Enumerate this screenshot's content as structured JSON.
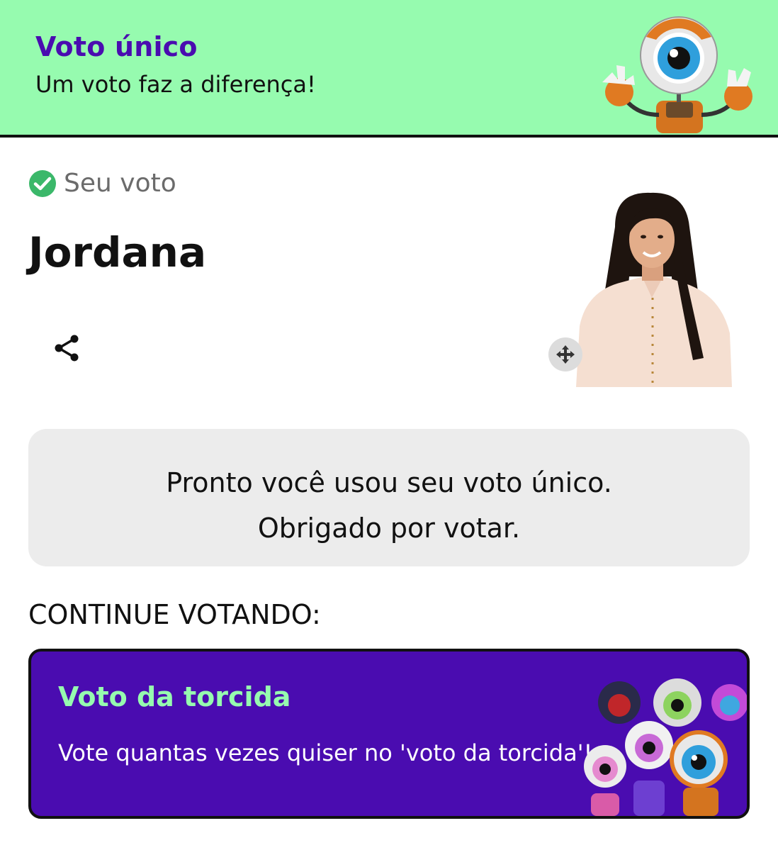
{
  "header": {
    "title": "Voto único",
    "subtitle": "Um voto faz a diferença!",
    "mascot_icon": "big-brother-eye-robot"
  },
  "vote": {
    "status_label": "Seu voto",
    "status_icon": "check-circle-icon",
    "candidate_name": "Jordana",
    "share_icon": "share-icon",
    "move_icon": "move-arrows-icon"
  },
  "notice": {
    "line1": "Pronto você usou seu voto único.",
    "line2": "Obrigado por votar."
  },
  "continue_label": "CONTINUE VOTANDO:",
  "fan_vote_card": {
    "title": "Voto da torcida",
    "description": "Vote quantas vezes quiser no 'voto da torcida'!"
  },
  "colors": {
    "banner_bg": "#96fbaf",
    "brand_purple": "#4a0cb0",
    "success_green": "#3bb86a",
    "notice_bg": "#ececec"
  }
}
